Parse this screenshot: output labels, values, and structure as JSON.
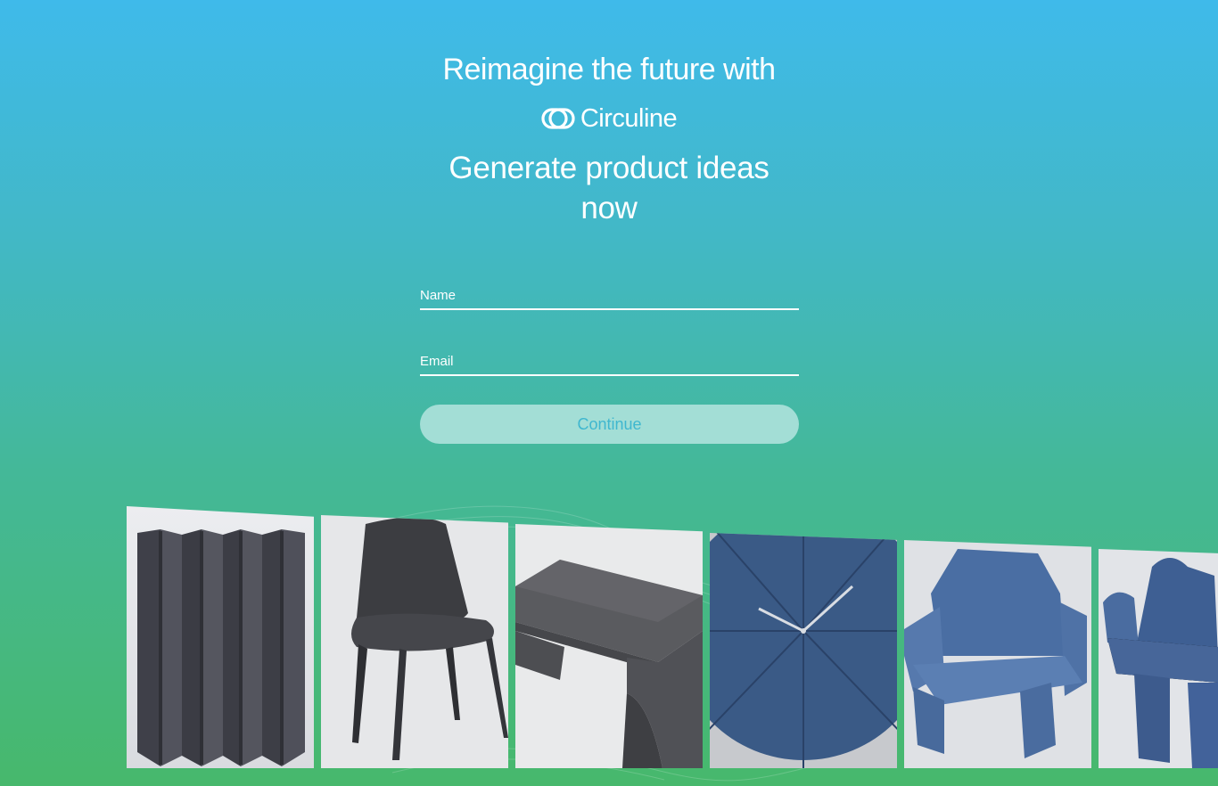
{
  "hero": {
    "headline": "Reimagine the future with",
    "brand_name": "Circuline",
    "subtitle": "Generate product ideas now"
  },
  "form": {
    "name_placeholder": "Name",
    "email_placeholder": "Email",
    "continue_label": "Continue"
  },
  "colors": {
    "gradient_top": "#3fbaea",
    "gradient_bottom": "#47b86c",
    "button_bg": "#a3ded6",
    "button_text": "#3fb7cf"
  },
  "gallery": {
    "items": [
      {
        "name": "folding-screen-image"
      },
      {
        "name": "chair-image"
      },
      {
        "name": "bench-image"
      },
      {
        "name": "wall-clock-image"
      },
      {
        "name": "armchair-image"
      },
      {
        "name": "sculptural-chair-image"
      }
    ]
  }
}
